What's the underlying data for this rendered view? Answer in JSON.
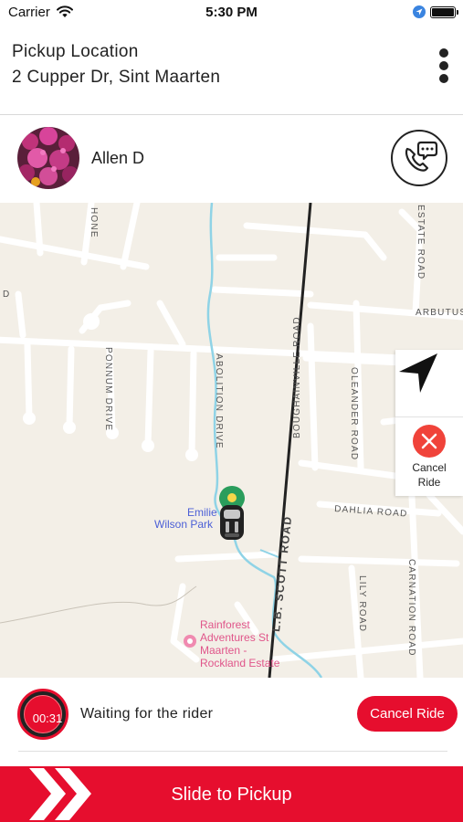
{
  "status_bar": {
    "carrier": "Carrier",
    "time": "5:30 PM"
  },
  "header": {
    "title": "Pickup Location",
    "address": "2 Cupper Dr, Sint Maarten"
  },
  "rider": {
    "name": "Allen D"
  },
  "map": {
    "roads": [
      "L.B. SCOTT ROAD",
      "BOUGHAINVILLE ROAD",
      "ABOLITION DRIVE",
      "PONNUM DRIVE",
      "OLEANDER ROAD",
      "DAHLIA ROAD",
      "LILY ROAD",
      "CARNATION ROAD",
      "ARBUTUS",
      "ESTATE ROAD",
      "HONE",
      "D"
    ],
    "places": [
      "Emilie",
      "Wilson Park",
      "Rainforest",
      "Adventures St",
      "Maarten -",
      "Rockland Estate"
    ],
    "cancel_label_line1": "Cancel",
    "cancel_label_line2": "Ride"
  },
  "waiting": {
    "timer": "00:31",
    "text": "Waiting for the rider",
    "cancel_label": "Cancel Ride"
  },
  "slider": {
    "label": "Slide to Pickup"
  },
  "colors": {
    "accent": "#e60e2e",
    "map_background": "#f3efe7",
    "cancel_icon": "#f0433a"
  },
  "icons": [
    "wifi-icon",
    "location-arrow-icon",
    "battery-icon",
    "more-vertical-icon",
    "phone-chat-icon",
    "navigation-arrow-icon",
    "close-icon",
    "car-marker-icon",
    "pin-icon",
    "chevron-double-right-icon"
  ]
}
